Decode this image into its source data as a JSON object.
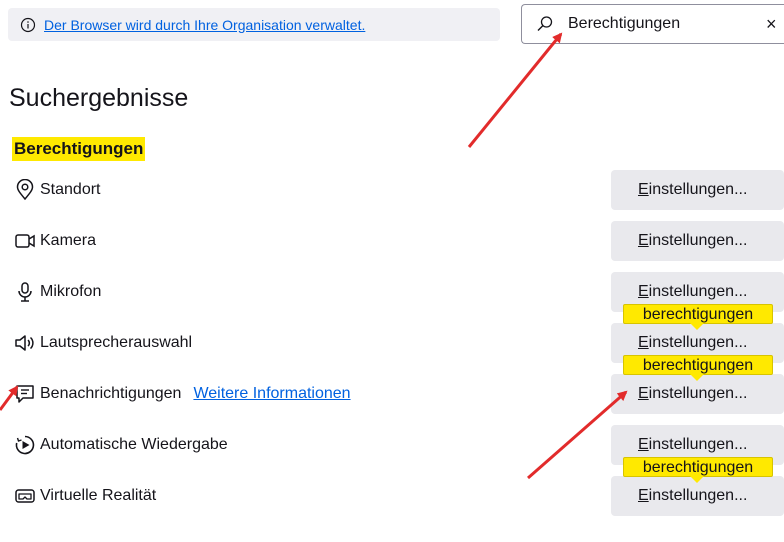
{
  "notice": {
    "text": "Der Browser wird durch Ihre Organisation verwaltet."
  },
  "search": {
    "value": "Berechtigungen",
    "clear": "×"
  },
  "results": {
    "heading": "Suchergebnisse",
    "category": "Berechtigungen",
    "rows": [
      {
        "label": "Standort",
        "icon": "location-icon",
        "button": "Einstellungen..."
      },
      {
        "label": "Kamera",
        "icon": "camera-icon",
        "button": "Einstellungen..."
      },
      {
        "label": "Mikrofon",
        "icon": "microphone-icon",
        "button": "Einstellungen..."
      },
      {
        "label": "Lautsprecherauswahl",
        "icon": "speaker-icon",
        "button": "Einstellungen..."
      },
      {
        "label": "Benachrichtigungen",
        "icon": "notification-icon",
        "button": "Einstellungen...",
        "link": "Weitere Informationen"
      },
      {
        "label": "Automatische Wiedergabe",
        "icon": "autoplay-icon",
        "button": "Einstellungen..."
      },
      {
        "label": "Virtuelle Realität",
        "icon": "vr-icon",
        "button": "Einstellungen..."
      }
    ],
    "tooltip": "berechtigungen"
  },
  "colors": {
    "accent": "#0061e0",
    "highlight": "#ffe900",
    "annotation": "#e22b2b"
  }
}
